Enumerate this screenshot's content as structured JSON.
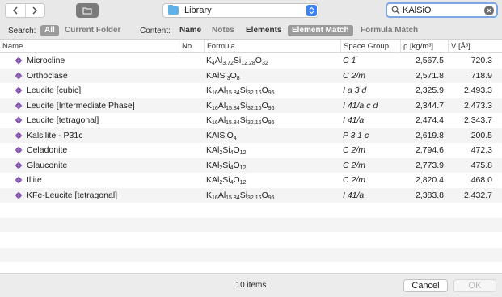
{
  "toolbar": {
    "location": "Library",
    "search_value": "KAlSiO"
  },
  "scope": {
    "search_label": "Search:",
    "search_scopes": [
      "All",
      "Current Folder"
    ],
    "content_label": "Content:",
    "content_scopes": [
      "Name",
      "Notes",
      "Elements",
      "Element Match",
      "Formula Match"
    ],
    "active_search_scope": "All",
    "active_content_scope": "Element Match"
  },
  "columns": [
    "Name",
    "No.",
    "Formula",
    "Space Group",
    "ρ [kg/m³]",
    "V [Å³]"
  ],
  "rows": [
    {
      "name": "Microcline",
      "formula": [
        [
          "K",
          "4"
        ],
        [
          "Al",
          "3.72"
        ],
        [
          "Si",
          "12.28"
        ],
        [
          "O",
          "32"
        ]
      ],
      "space_group": "C 1̅",
      "rho": "2,567.5",
      "volume": "720.3"
    },
    {
      "name": "Orthoclase",
      "formula": [
        [
          "KAlSi",
          "3"
        ],
        [
          "O",
          "8"
        ]
      ],
      "space_group": "C 2/m",
      "rho": "2,571.8",
      "volume": "718.9"
    },
    {
      "name": "Leucite [cubic]",
      "formula": [
        [
          "K",
          "16"
        ],
        [
          "Al",
          "15.84"
        ],
        [
          "Si",
          "32.16"
        ],
        [
          "O",
          "96"
        ]
      ],
      "space_group": "I a 3̅ d",
      "rho": "2,325.9",
      "volume": "2,493.3"
    },
    {
      "name": "Leucite [Intermediate Phase]",
      "formula": [
        [
          "K",
          "16"
        ],
        [
          "Al",
          "15.84"
        ],
        [
          "Si",
          "32.16"
        ],
        [
          "O",
          "96"
        ]
      ],
      "space_group": "I 41/a c d",
      "rho": "2,344.7",
      "volume": "2,473.3"
    },
    {
      "name": "Leucite [tetragonal]",
      "formula": [
        [
          "K",
          "16"
        ],
        [
          "Al",
          "15.84"
        ],
        [
          "Si",
          "32.16"
        ],
        [
          "O",
          "96"
        ]
      ],
      "space_group": "I 41/a",
      "rho": "2,474.4",
      "volume": "2,343.7"
    },
    {
      "name": "Kalsilite - P31c",
      "formula": [
        [
          "KAlSiO",
          "4"
        ]
      ],
      "space_group": "P 3 1 c",
      "rho": "2,619.8",
      "volume": "200.5"
    },
    {
      "name": "Celadonite",
      "formula": [
        [
          "KAl",
          "2"
        ],
        [
          "Si",
          "4"
        ],
        [
          "O",
          "12"
        ]
      ],
      "space_group": "C 2/m",
      "rho": "2,794.6",
      "volume": "472.3"
    },
    {
      "name": "Glauconite",
      "formula": [
        [
          "KAl",
          "2"
        ],
        [
          "Si",
          "4"
        ],
        [
          "O",
          "12"
        ]
      ],
      "space_group": "C 2/m",
      "rho": "2,773.9",
      "volume": "475.8"
    },
    {
      "name": "Illite",
      "formula": [
        [
          "KAl",
          "2"
        ],
        [
          "Si",
          "4"
        ],
        [
          "O",
          "12"
        ]
      ],
      "space_group": "C 2/m",
      "rho": "2,820.4",
      "volume": "468.0"
    },
    {
      "name": "KFe-Leucite [tetragonal]",
      "formula": [
        [
          "K",
          "16"
        ],
        [
          "Al",
          "15.84"
        ],
        [
          "Si",
          "32.16"
        ],
        [
          "O",
          "96"
        ]
      ],
      "space_group": "I 41/a",
      "rho": "2,383.8",
      "volume": "2,432.7"
    }
  ],
  "footer": {
    "count": "10 items",
    "cancel": "Cancel",
    "ok": "OK"
  },
  "icons": {
    "back": "chevron-left-icon",
    "forward": "chevron-right-icon",
    "new_folder": "folder-icon",
    "row": "crystal-icon"
  },
  "colors": {
    "accent": "#3b82f6",
    "gem": "#7b4aa8"
  }
}
